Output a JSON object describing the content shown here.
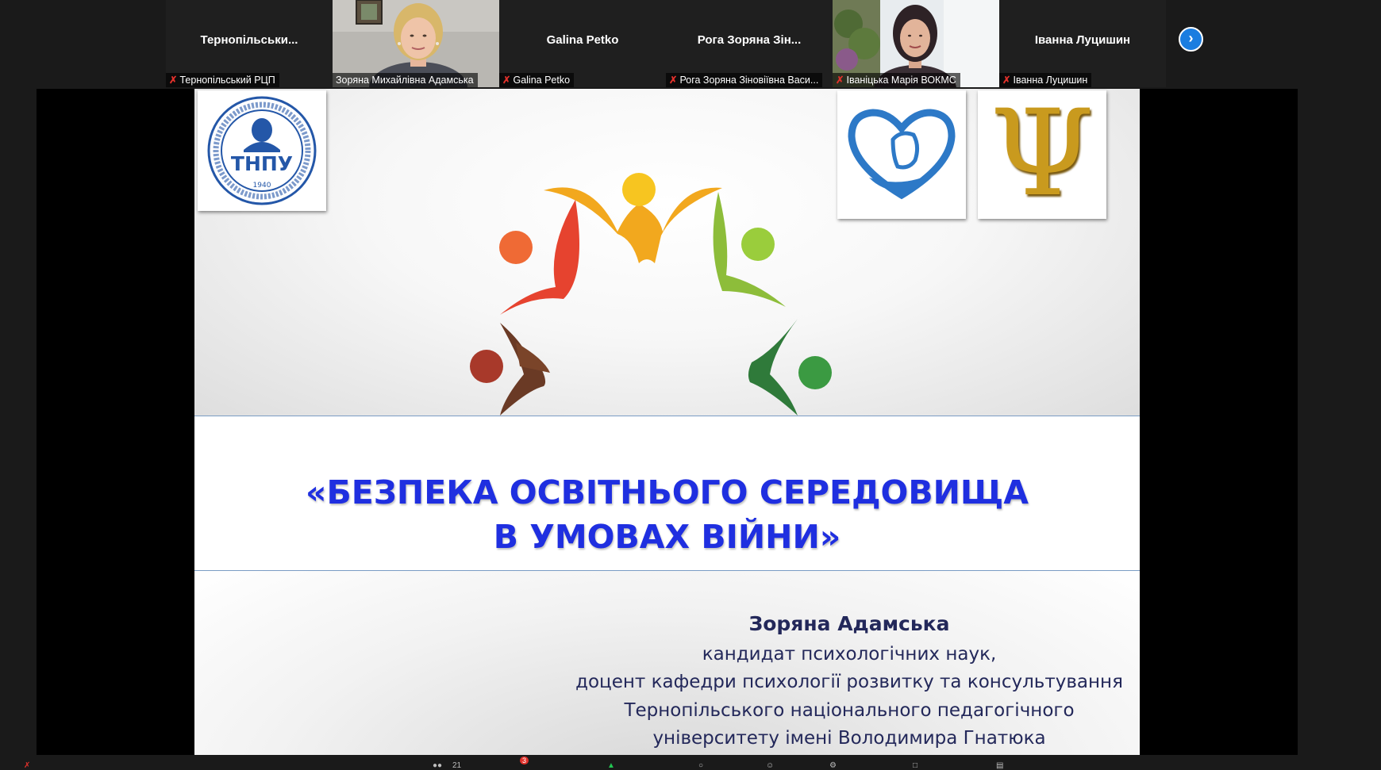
{
  "participants": [
    {
      "display": "Тернопільськи...",
      "label": "Тернопільський РЦП",
      "muted": true,
      "video": false
    },
    {
      "display": "",
      "label": "Зоряна Михайлівна Адамська",
      "muted": false,
      "video": true,
      "active": true
    },
    {
      "display": "Galina Petko",
      "label": "Galina Petko",
      "muted": true,
      "video": false
    },
    {
      "display": "Рога Зоряна Зін...",
      "label": "Рога Зоряна Зіновіївна Васи...",
      "muted": true,
      "video": false
    },
    {
      "display": "",
      "label": "Іваніцька Марія ВОКМС",
      "muted": true,
      "video": true
    },
    {
      "display": "Іванна Луцишин",
      "label": "Іванна Луцишин",
      "muted": true,
      "video": false
    }
  ],
  "next_icon": "chevron-right-icon",
  "slide": {
    "title_line1": "«БЕЗПЕКА ОСВІТНЬОГО СЕРЕДОВИЩА",
    "title_line2": "В УМОВАХ ВІЙНИ»",
    "author_name": "Зоряна Адамська",
    "author_lines": [
      "кандидат психологічних наук,",
      "доцент кафедри психології розвитку та консультування",
      "Тернопільського національного педагогічного",
      "університету імені Володимира Гнатюка"
    ],
    "logo_left_text": "ТНПУ",
    "logo_left_year": "1940",
    "logo_left_ring": "ТЕРНОПІЛЬСЬКИЙ НАЦІОНАЛЬНИЙ ПЕДАГОГІЧНИЙ УНІВЕРСИТЕТ ІМЕНІ ВОЛОДИМИРА ГНАТЮКА",
    "logo_right_symbol": "Ψ"
  },
  "colors": {
    "title": "#1f2fe0",
    "author": "#23285a",
    "active_speaker": "#6fbf4a",
    "next_button": "#1a7de0",
    "muted_icon": "#e0312b"
  },
  "toolbar": {
    "participants_count": "21",
    "chat_badge": "3"
  }
}
